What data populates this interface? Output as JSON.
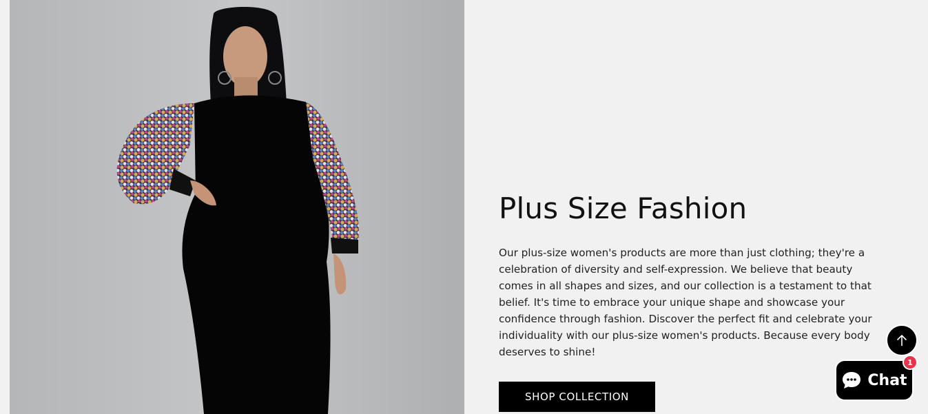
{
  "section": {
    "title": "Plus Size Fashion",
    "description": "Our plus-size women's products are more than just clothing; they're a celebration of diversity and self-expression. We believe that beauty comes in all shapes and sizes, and our collection is a testament to that belief. It's time to embrace your unique shape and showcase your confidence through fashion. Discover the perfect fit and celebrate your individuality with our plus-size women's products. Because every body deserves to shine!",
    "button_label": "SHOP COLLECTION"
  },
  "image": {
    "subject": "model-wearing-black-dress-with-sequin-sleeves",
    "background_color": "#bdbec0"
  },
  "widgets": {
    "back_to_top_icon": "arrow-up-icon",
    "chat_icon": "chat-bubble-icon",
    "chat_label": "Chat",
    "chat_badge_count": "1"
  },
  "colors": {
    "content_background": "#f1f1f1",
    "button_background": "#000000",
    "badge": "#e8334a"
  }
}
